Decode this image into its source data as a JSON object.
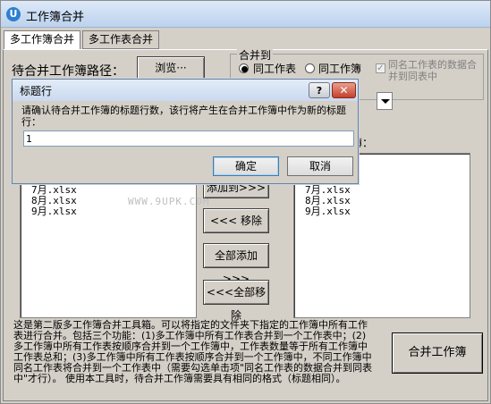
{
  "window": {
    "title": "工作簿合并"
  },
  "tabs": [
    "多工作簿合并",
    "多工作表合并"
  ],
  "path_label": "待合并工作簿路径：",
  "browse_label": "浏览···",
  "merge_group": {
    "label": "合并到",
    "option1": "同工作表",
    "option2": "同工作簿",
    "checkbox_label": "同名工作表的数据合并到同表中"
  },
  "tablist_label": "簿：",
  "left_list": [
    "7月.xlsx",
    "8月.xlsx",
    "9月.xlsx"
  ],
  "right_list": [
    "7月.xlsx",
    "8月.xlsx",
    "9月.xlsx"
  ],
  "watermark": "WWW.9UPK.COM",
  "buttons": {
    "add": "添加到>>>",
    "remove": "<<< 移除",
    "add_all": "全部添加>>>",
    "remove_all": "<<<全部移除",
    "merge": "合并工作簿"
  },
  "description": "这是第二版多工作簿合并工具箱。可以将指定的文件夹下指定的工作簿中所有工作表进行合并。包括三个功能：(1)多工作簿中所有工作表合并到一个工作表中；(2)多工作簿中所有工作表按顺序合并到一个工作簿中，工作表数量等于所有工作簿中工作表总和；(3)多工作簿中所有工作表按顺序合并到一个工作簿中，不同工作簿中同名工作表将合并到一个工作表中（需要勾选单击项\"同名工作表的数据合并到同表中\"才行）。 使用本工具时，待合并工作簿需要具有相同的格式（标题相同）。",
  "dialog": {
    "title": "标题行",
    "message": "请确认待合并工作簿的标题行数，该行将产生在合并工作簿中作为新的标题行：",
    "input_value": "1",
    "help": "?",
    "close": "✕",
    "ok": "确定",
    "cancel": "取消"
  }
}
